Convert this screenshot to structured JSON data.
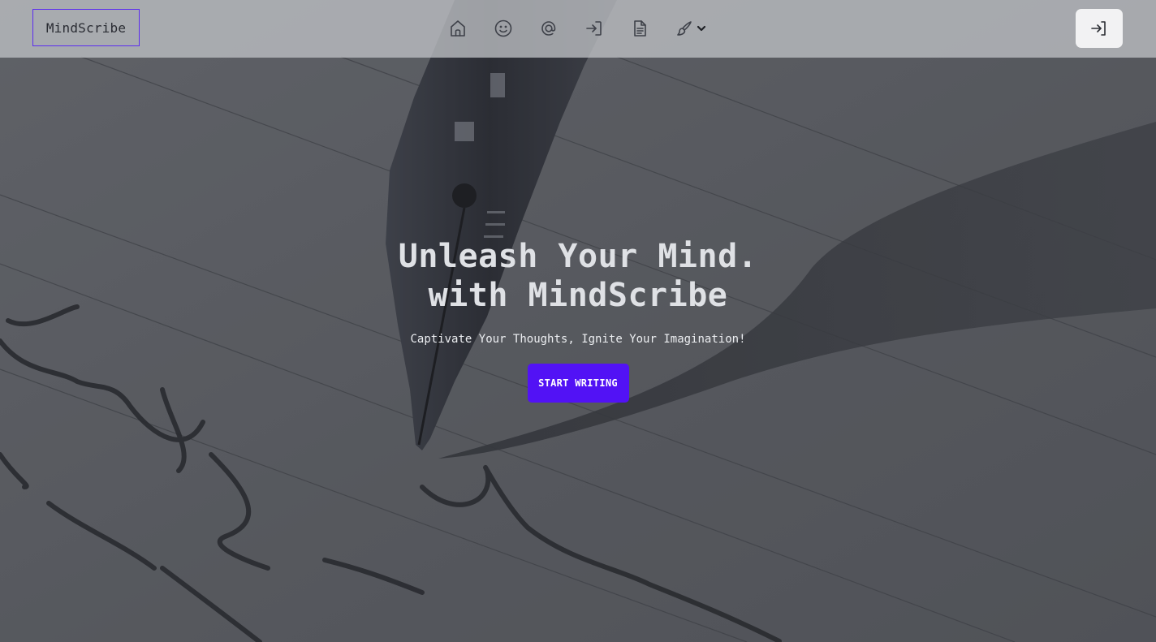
{
  "header": {
    "logo_text": "MindScribe",
    "nav": [
      {
        "icon": "home-icon"
      },
      {
        "icon": "smiley-icon"
      },
      {
        "icon": "at-sign-icon"
      },
      {
        "icon": "sign-in-icon"
      },
      {
        "icon": "document-icon"
      },
      {
        "icon": "paintbrush-icon",
        "dropdown": "chevron-down-icon"
      }
    ],
    "login_icon": "sign-in-icon"
  },
  "hero": {
    "headline_line1": "Unleash Your Mind.",
    "headline_line2": "with MindScribe",
    "subtitle": "Captivate Your Thoughts, Ignite Your Imagination!",
    "cta_label": "START WRITING",
    "background": "fountain-pen-writing-on-paper-photo"
  },
  "colors": {
    "accent": "#5212f5",
    "logo_border": "#5b2cf0",
    "topbar": "#c0c2c6",
    "overlay": "#5b5e62",
    "headline": "#dfe1e5"
  }
}
